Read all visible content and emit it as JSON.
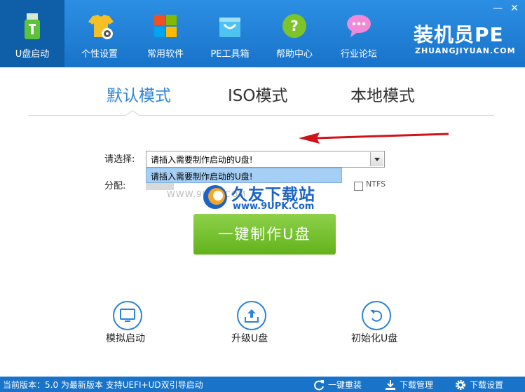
{
  "header": {
    "nav": [
      {
        "label": "U盘启动",
        "icon": "usb-drive-icon"
      },
      {
        "label": "个性设置",
        "icon": "shirt-gear-icon"
      },
      {
        "label": "常用软件",
        "icon": "windows-logo-icon"
      },
      {
        "label": "PE工具箱",
        "icon": "shopping-bag-icon"
      },
      {
        "label": "帮助中心",
        "icon": "question-icon"
      },
      {
        "label": "行业论坛",
        "icon": "chat-bubble-icon"
      }
    ],
    "brand": "装机员PE",
    "brand_sub": "ZHUANGJIYUAN.COM",
    "window": {
      "minimize": "—",
      "close": "✕"
    }
  },
  "tabs": [
    {
      "label": "默认模式",
      "active": true
    },
    {
      "label": "ISO模式",
      "active": false
    },
    {
      "label": "本地模式",
      "active": false
    }
  ],
  "form": {
    "select_label": "请选择:",
    "select_value": "请插入需要制作启动的U盘!",
    "dropdown_option": "请插入需要制作启动的U盘!",
    "alloc_label": "分配:",
    "check_label": "NTFS"
  },
  "watermark": {
    "title": "久友下载站",
    "url": "www.9UPK.Com",
    "left_text": "WWW.9UPK.COM"
  },
  "make_button": "一键制作U盘",
  "actions": [
    {
      "label": "模拟启动",
      "icon": "monitor-icon"
    },
    {
      "label": "升级U盘",
      "icon": "upload-icon"
    },
    {
      "label": "初始化U盘",
      "icon": "undo-icon"
    }
  ],
  "status": {
    "text": "当前版本：5.0 为最新版本 支持UEFI+UD双引导启动",
    "items": [
      {
        "label": "一键重装",
        "icon": "refresh-icon"
      },
      {
        "label": "下载管理",
        "icon": "download-icon"
      },
      {
        "label": "下载设置",
        "icon": "gear-icon"
      }
    ]
  },
  "colors": {
    "header": "#1e7fd6",
    "accent": "#2c84d6",
    "button_green": "#6dbb26",
    "arrow_red": "#d0121b"
  }
}
